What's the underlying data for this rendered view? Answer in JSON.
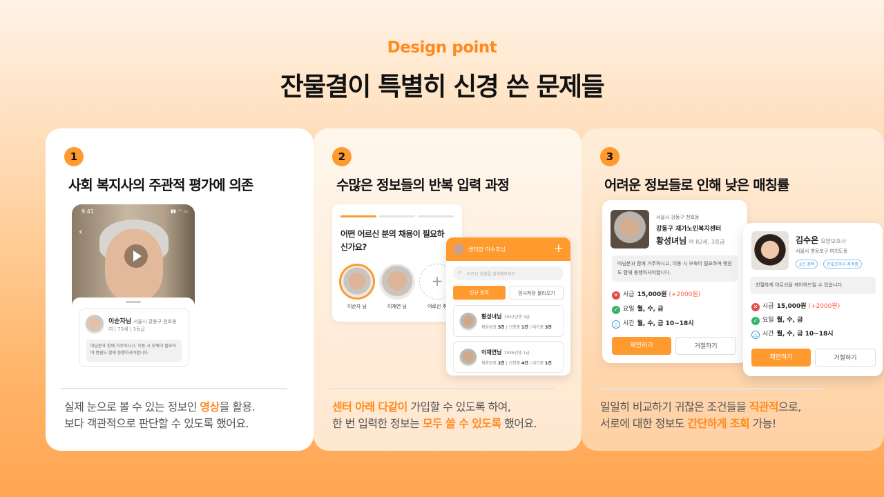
{
  "header": {
    "eyebrow": "Design point",
    "headline": "잔물결이 특별히 신경 쓴 문제들"
  },
  "cards": [
    {
      "number": "1",
      "title": "사회 복지사의 주관적 평가에 의존",
      "desc_line1_a": "실제 눈으로 볼 수 있는 정보인 ",
      "desc_line1_hl": "영상",
      "desc_line1_b": "을 활용.",
      "desc_line2": "보다 객관적으로 판단할 수 있도록 했어요."
    },
    {
      "number": "2",
      "title": "수많은 정보들의 반복 입력 과정",
      "desc_line1_hl": "센터 아래 다같이",
      "desc_line1_b": " 가입할 수 있도록 하여,",
      "desc_line2_a": "한 번 입력한 정보는 ",
      "desc_line2_hl": "모두 쓸 수 있도록",
      "desc_line2_b": " 했어요."
    },
    {
      "number": "3",
      "title": "어려운 정보들로 인해 낮은 매칭률",
      "desc_line1_a": "일일히 비교하기 귀찮은 조건들을 ",
      "desc_line1_hl": "직관적",
      "desc_line1_b": "으로,",
      "desc_line2_a": "서로에 대한 정보도 ",
      "desc_line2_hl": "간단하게 조회",
      "desc_line2_b": " 가능!"
    }
  ],
  "mock1": {
    "time": "9:41",
    "status_icons": "▮▮ ◠ ▭",
    "name": "이순자님",
    "location": "서울시 강동구 천호동",
    "meta": "여  |  75세  |  3등급",
    "note": "따님분과 함께 거주하시고, 이동 시 부축이 필요하며 병원도 함께 동행하셔야합니다."
  },
  "mock2": {
    "question": "어떤 어르신 분의 채용이 필요하신가요?",
    "options": [
      "이순자 님",
      "이재연 님",
      "어르신 추"
    ],
    "center_title": "센터장 이수호님",
    "search_placeholder": "어르신 성함을 검색해보세요",
    "tab_new": "신규 등록",
    "tab_saved": "임시저장 불러오기",
    "rows": [
      {
        "name": "황성녀님",
        "sub": "1952년생 3급",
        "stats_a": "채용완료 ",
        "v1": "5건",
        "stats_b": "  |  신청중 ",
        "v2": "1건",
        "stats_c": "  |  대기중 ",
        "v3": "3건"
      },
      {
        "name": "이재연님",
        "sub": "1946년생 1급",
        "stats_a": "채용완료 ",
        "v1": "2건",
        "stats_b": "  |  신청중 ",
        "v2": "4건",
        "stats_c": "  |  대기중 ",
        "v3": "1건"
      }
    ]
  },
  "mock3": {
    "a": {
      "location": "서울시 강동구 천호동",
      "org": "강동구 재가노인복지센터",
      "name": "황성녀님",
      "sub": "여 82세, 3등급",
      "note": "따님분과 함께 거주하시고, 이동 시 부축이 필요하며 병원도 함께 동행하셔야합니다.",
      "wage_label": "시급",
      "wage": "15,000원",
      "wage_plus": "(+2000원)",
      "days_label": "요일",
      "days": "월, 수, 금",
      "time_label": "시간",
      "time": "월, 수, 금 10~18시",
      "accept": "제안하기",
      "decline": "거절하기"
    },
    "b": {
      "name": "김수은",
      "role": "요양보호사",
      "location": "서울시 영등포구 여의도동",
      "tag1": "2년 경력",
      "tag2": "간호조무사 자격증",
      "note": "친절하게 어르신을 케어하드릴 수 있습니다.",
      "wage_label": "시급",
      "wage": "15,000원",
      "wage_plus": "(+2000원)",
      "days_label": "요일",
      "days": "월, 수, 금",
      "time_label": "시간",
      "time": "월, 수, 금 10~18시",
      "accept": "제안하기",
      "decline": "거절하기"
    }
  },
  "colors": {
    "accent": "#ff9a2e",
    "highlight": "#ff8a1e",
    "bg_top": "#fff3e6",
    "bg_bottom": "#ffa552"
  }
}
